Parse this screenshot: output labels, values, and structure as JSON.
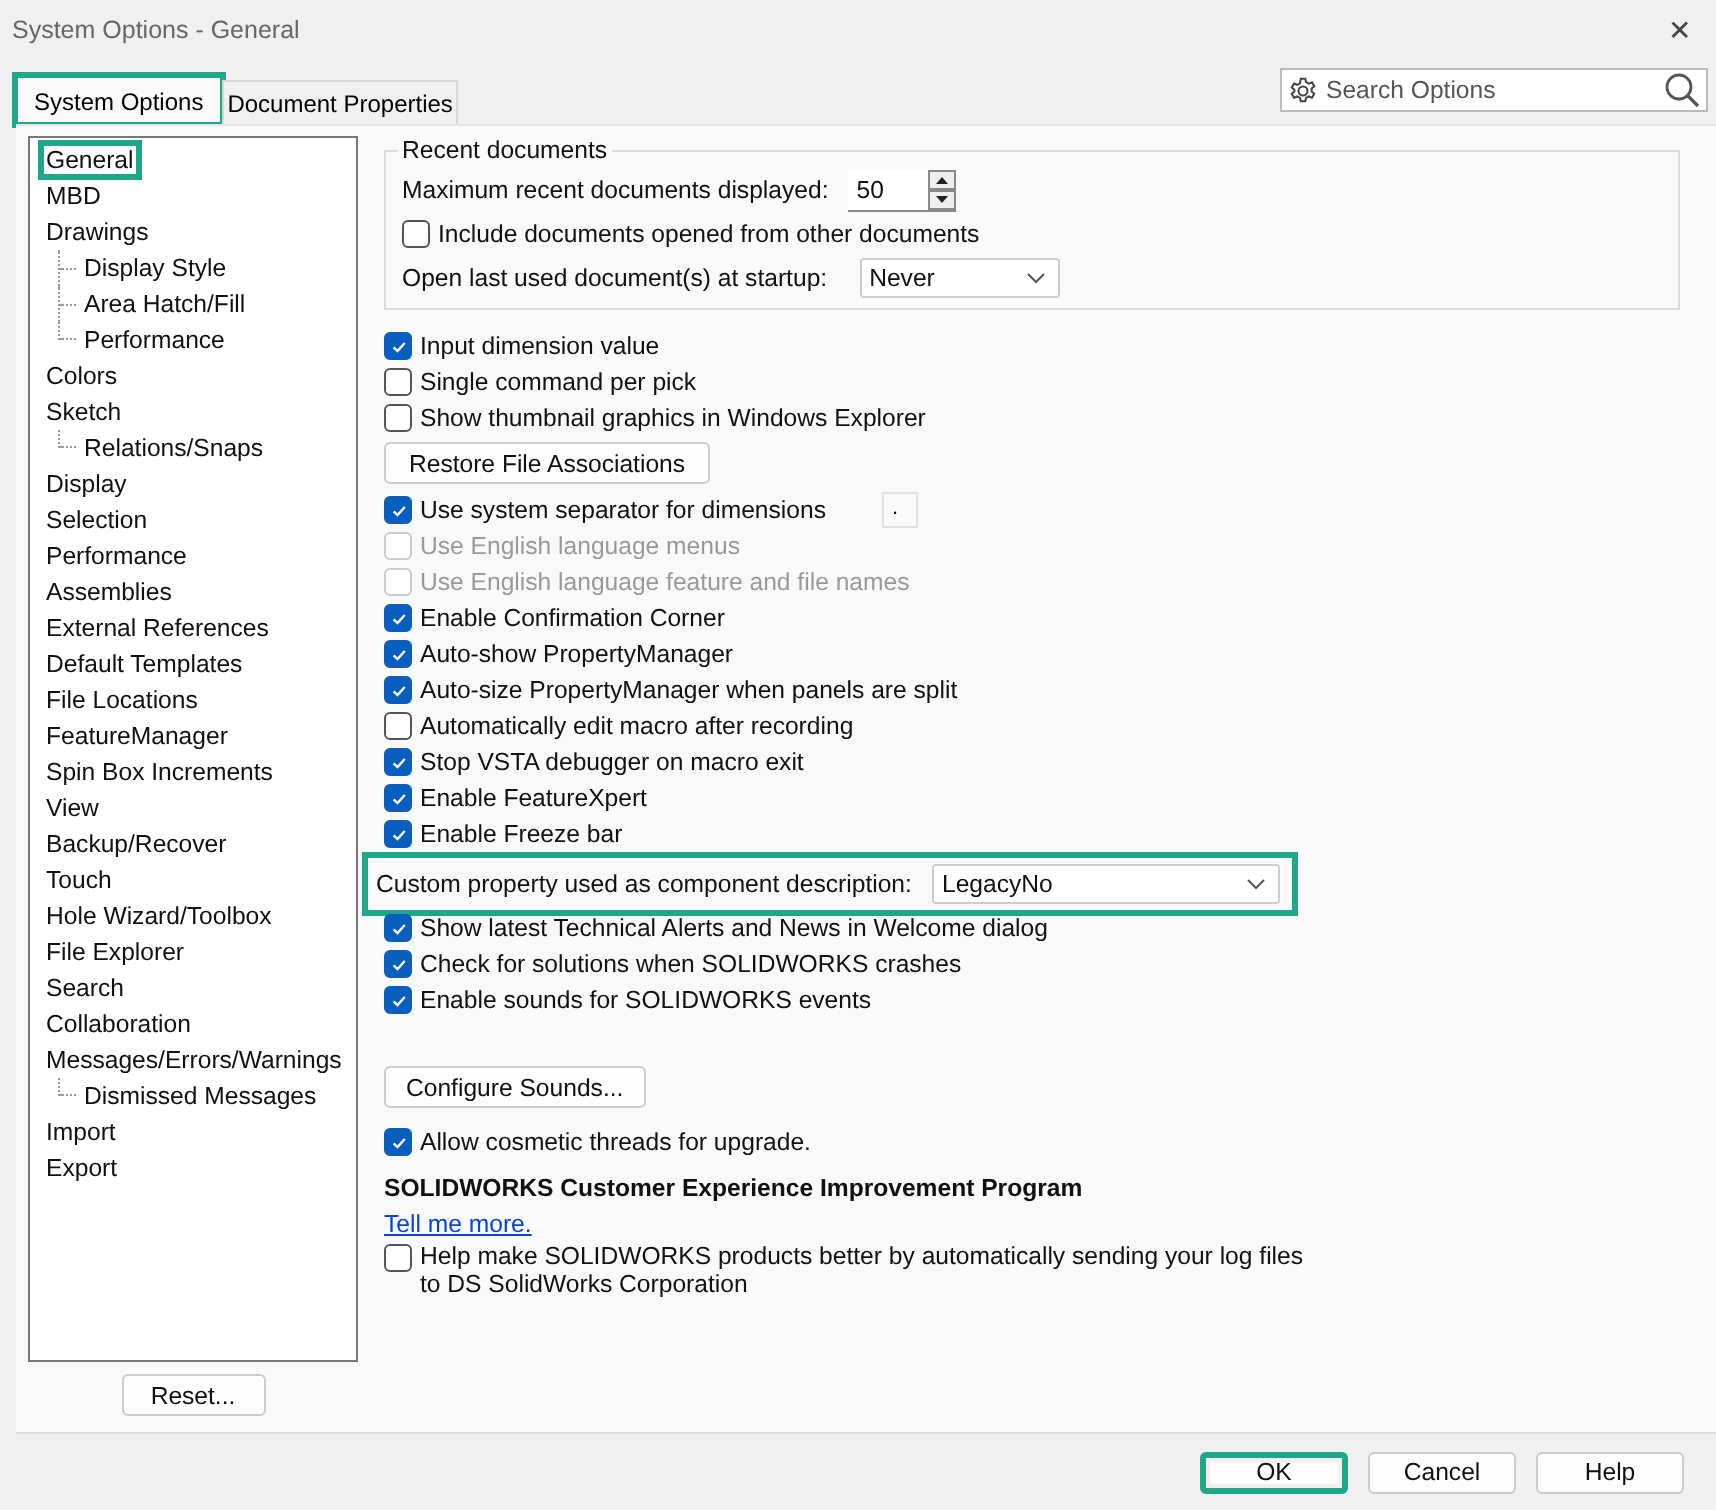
{
  "window": {
    "title": "System Options - General",
    "close": "✕"
  },
  "tabs": [
    {
      "label": "System Options",
      "selected": true,
      "highlighted": true
    },
    {
      "label": "Document Properties",
      "selected": false,
      "highlighted": false
    }
  ],
  "search": {
    "placeholder": "Search Options"
  },
  "sidebar": {
    "items": [
      {
        "label": "General",
        "highlighted": true
      },
      {
        "label": "MBD",
        "highlighted": false
      },
      {
        "label": "Drawings",
        "highlighted": false,
        "children": [
          {
            "label": "Display Style",
            "highlighted": false
          },
          {
            "label": "Area Hatch/Fill",
            "highlighted": false
          },
          {
            "label": "Performance",
            "highlighted": false
          }
        ]
      },
      {
        "label": "Colors",
        "highlighted": false
      },
      {
        "label": "Sketch",
        "highlighted": false,
        "children": [
          {
            "label": "Relations/Snaps",
            "highlighted": false
          }
        ]
      },
      {
        "label": "Display",
        "highlighted": false
      },
      {
        "label": "Selection",
        "highlighted": false
      },
      {
        "label": "Performance",
        "highlighted": false
      },
      {
        "label": "Assemblies",
        "highlighted": false
      },
      {
        "label": "External References",
        "highlighted": false
      },
      {
        "label": "Default Templates",
        "highlighted": false
      },
      {
        "label": "File Locations",
        "highlighted": false
      },
      {
        "label": "FeatureManager",
        "highlighted": false
      },
      {
        "label": "Spin Box Increments",
        "highlighted": false
      },
      {
        "label": "View",
        "highlighted": false
      },
      {
        "label": "Backup/Recover",
        "highlighted": false
      },
      {
        "label": "Touch",
        "highlighted": false
      },
      {
        "label": "Hole Wizard/Toolbox",
        "highlighted": false
      },
      {
        "label": "File Explorer",
        "highlighted": false
      },
      {
        "label": "Search",
        "highlighted": false
      },
      {
        "label": "Collaboration",
        "highlighted": false
      },
      {
        "label": "Messages/Errors/Warnings",
        "highlighted": false,
        "children": [
          {
            "label": "Dismissed Messages",
            "highlighted": false
          }
        ]
      },
      {
        "label": "Import",
        "highlighted": false
      },
      {
        "label": "Export",
        "highlighted": false
      }
    ],
    "reset_button": "Reset..."
  },
  "recent_documents": {
    "title": "Recent documents",
    "max_label": "Maximum recent documents displayed:",
    "max_value": "50",
    "include_label": "Include documents opened from other documents",
    "include_checked": false,
    "open_last_label": "Open last used document(s) at startup:",
    "open_last_value": "Never"
  },
  "options": [
    {
      "kind": "checkbox",
      "label": "Input dimension value",
      "checked": true,
      "disabled": false
    },
    {
      "kind": "checkbox",
      "label": "Single command per pick",
      "checked": false,
      "disabled": false
    },
    {
      "kind": "checkbox",
      "label": "Show thumbnail graphics in Windows Explorer",
      "checked": false,
      "disabled": false
    },
    {
      "kind": "button",
      "label": "Restore File Associations"
    },
    {
      "kind": "checkbox",
      "label": "Use system separator for dimensions",
      "checked": true,
      "disabled": false,
      "value": "."
    },
    {
      "kind": "checkbox",
      "label": "Use English language menus",
      "checked": false,
      "disabled": true
    },
    {
      "kind": "checkbox",
      "label": "Use English language feature and file names",
      "checked": false,
      "disabled": true
    },
    {
      "kind": "checkbox",
      "label": "Enable Confirmation Corner",
      "checked": true,
      "disabled": false
    },
    {
      "kind": "checkbox",
      "label": "Auto-show PropertyManager",
      "checked": true,
      "disabled": false
    },
    {
      "kind": "checkbox",
      "label": "Auto-size PropertyManager when panels are split",
      "checked": true,
      "disabled": false
    },
    {
      "kind": "checkbox",
      "label": "Automatically edit macro after recording",
      "checked": false,
      "disabled": false
    },
    {
      "kind": "checkbox",
      "label": "Stop VSTA debugger on macro exit",
      "checked": true,
      "disabled": false
    },
    {
      "kind": "checkbox",
      "label": "Enable FeatureXpert",
      "checked": true,
      "disabled": false
    },
    {
      "kind": "checkbox",
      "label": "Enable Freeze bar",
      "checked": true,
      "disabled": false
    },
    {
      "kind": "select",
      "label": "Custom property used as component description:",
      "value": "LegacyNo",
      "highlighted": true
    },
    {
      "kind": "checkbox",
      "label": "Show latest Technical Alerts and News in Welcome dialog",
      "checked": true,
      "disabled": false
    },
    {
      "kind": "checkbox",
      "label": "Check for solutions when SOLIDWORKS crashes",
      "checked": true,
      "disabled": false
    },
    {
      "kind": "checkbox",
      "label": "Enable sounds for SOLIDWORKS events",
      "checked": true,
      "disabled": false
    }
  ],
  "configure_sounds_button": "Configure Sounds...",
  "cosmetic_threads": {
    "label": "Allow cosmetic threads for upgrade.",
    "checked": true
  },
  "ceip": {
    "heading": "SOLIDWORKS Customer Experience Improvement Program",
    "link": "Tell me more.",
    "checkbox": {
      "label": "Help make SOLIDWORKS products better by automatically sending your log files to DS SolidWorks Corporation",
      "checked": false
    }
  },
  "buttons": [
    {
      "label": "OK",
      "highlighted": true
    },
    {
      "label": "Cancel",
      "highlighted": false
    },
    {
      "label": "Help",
      "highlighted": false
    }
  ]
}
